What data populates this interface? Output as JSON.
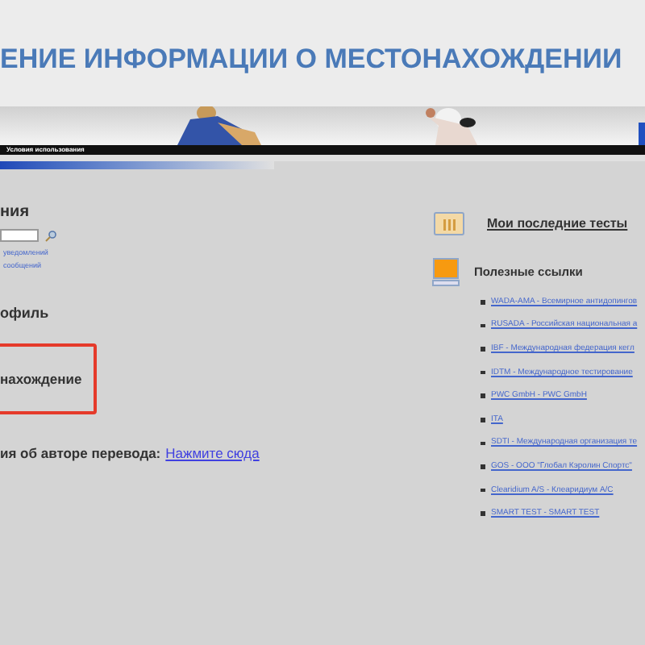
{
  "slide_title": "ЕНИЕ ИНФОРМАЦИИ О МЕСТОНАХОЖДЕНИИ",
  "banner": {
    "menu_text": "Условия использования"
  },
  "left": {
    "search_heading": "ния",
    "links": [
      "уведомлений",
      "сообщений"
    ],
    "profile_heading": "офиль",
    "highlighted_heading": "нахождение",
    "translator_label": "ия об авторе перевода:",
    "translator_link": "Нажмите сюда"
  },
  "right": {
    "recent_tests": "Мои последние тесты",
    "useful_links_heading": "Полезные ссылки",
    "links": [
      "WADA-AMA - Всемирное антидопингов",
      "RUSADA - Российская национальная а",
      "IBF - Международная федерация кегл",
      "IDTM - Международное тестирование",
      "PWC GmbH - PWC GmbH",
      "ITA",
      "SDTI - Международная организация те",
      "GOS - ООО \"Глобал Кэролин Спортс\"",
      "Clearidium A/S - Клеаридиум A/C",
      "SMART TEST - SMART TEST"
    ]
  }
}
